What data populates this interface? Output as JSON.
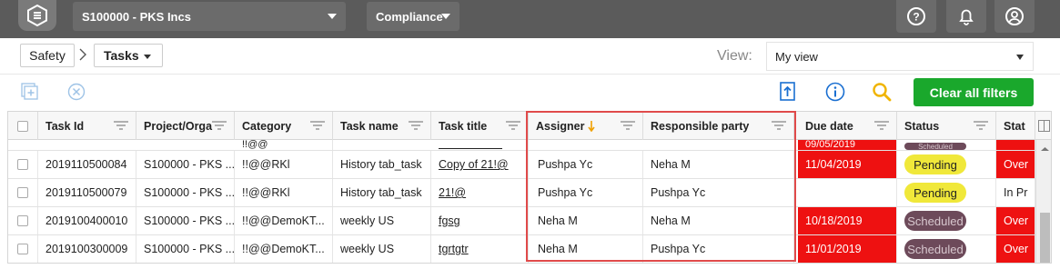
{
  "topbar": {
    "org_label": "S100000 - PKS Incs",
    "compliance_label": "Compliance"
  },
  "breadcrumb": {
    "items": [
      "Safety",
      "Tasks"
    ]
  },
  "view": {
    "label": "View:",
    "value": "My view"
  },
  "toolbar": {
    "clear_filters_label": "Clear all filters"
  },
  "grid": {
    "columns": [
      "Task Id",
      "Project/Orga",
      "Category",
      "Task name",
      "Task title",
      "Assigner",
      "Responsible party",
      "Due date",
      "Status",
      "Stat"
    ],
    "partial_row": {
      "category": "!!@@",
      "due_date": "09/05/2019",
      "status": "Scheduled"
    },
    "rows": [
      {
        "task_id": "2019110500084",
        "project": "S100000 - PKS ...",
        "category": "!!@@RKl",
        "task_name": "History tab_task",
        "task_title": "Copy of 21!@",
        "assigner": "Pushpa Yc",
        "responsible": "Neha M",
        "due_date": "11/04/2019",
        "status": "Pending",
        "stat2": "Over"
      },
      {
        "task_id": "2019110500079",
        "project": "S100000 - PKS ...",
        "category": "!!@@RKl",
        "task_name": "History tab_task",
        "task_title": "21!@",
        "assigner": "Pushpa Yc",
        "responsible": "Pushpa Yc",
        "due_date": "",
        "status": "Pending",
        "stat2": "In Pr"
      },
      {
        "task_id": "2019100400010",
        "project": "S100000 - PKS ...",
        "category": "!!@@DemoKT...",
        "task_name": "weekly US",
        "task_title": "fgsg",
        "assigner": "Neha M",
        "responsible": "Neha M",
        "due_date": "10/18/2019",
        "status": "Scheduled",
        "stat2": "Over"
      },
      {
        "task_id": "2019100300009",
        "project": "S100000 - PKS ...",
        "category": "!!@@DemoKT...",
        "task_name": "weekly US",
        "task_title": "tgrtgtr",
        "assigner": "Neha M",
        "responsible": "Pushpa Yc",
        "due_date": "11/01/2019",
        "status": "Scheduled",
        "stat2": "Over"
      }
    ]
  },
  "colors": {
    "accent_green": "#1aa82c",
    "overdue_red": "#ee1111",
    "pending_yellow": "#f0e83a",
    "scheduled_purple": "#6d4a5a",
    "highlight_red": "#e04a4a"
  }
}
